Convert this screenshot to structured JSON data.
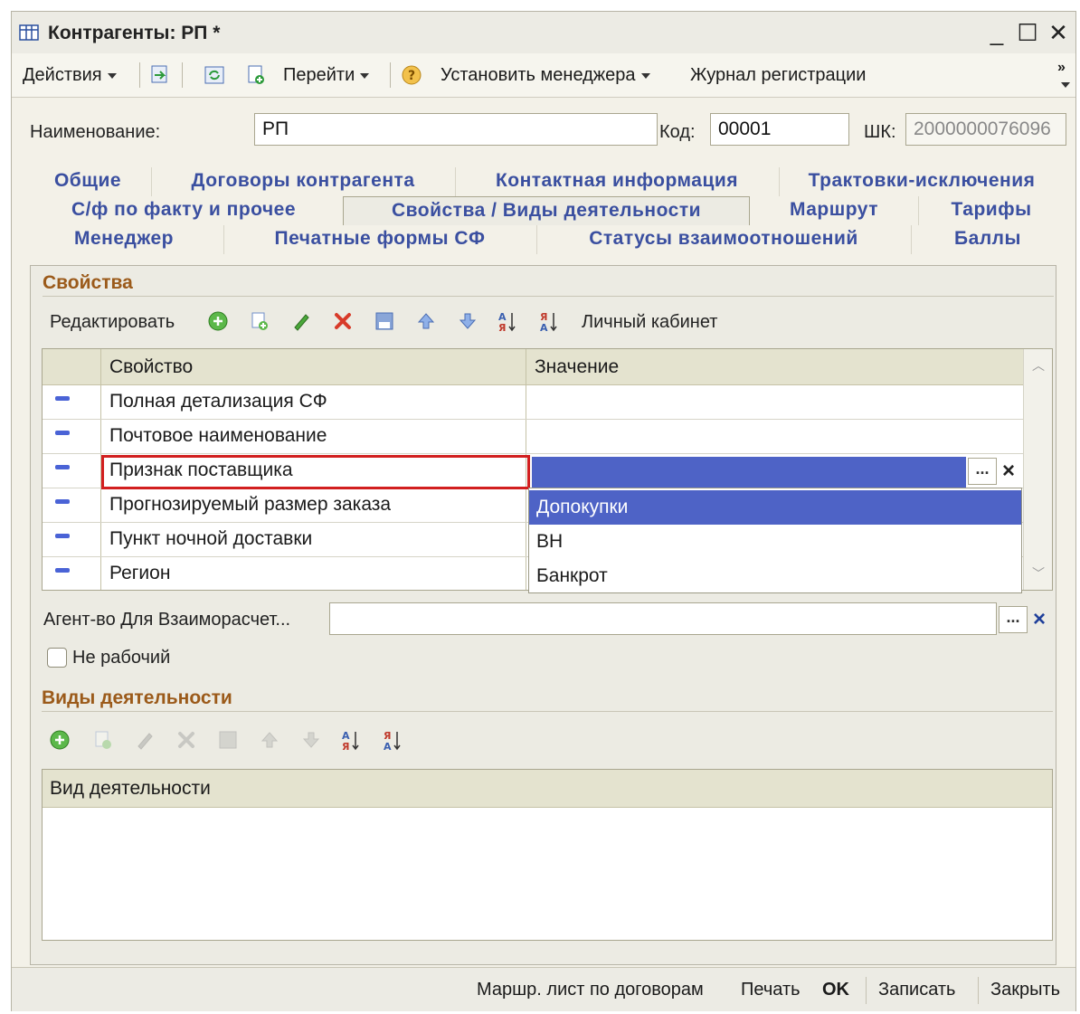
{
  "window": {
    "title": "Контрагенты: РП *",
    "minimize": "_",
    "maximize": "☐",
    "close": "✕"
  },
  "toolbar": {
    "actions": "Действия",
    "goto": "Перейти",
    "set_manager": "Установить менеджера",
    "registration_log": "Журнал регистрации",
    "more": "»"
  },
  "form": {
    "name_label": "Наименование:",
    "name_value": "РП",
    "code_label": "Код:",
    "code_value": "00001",
    "barcode_label": "ШК:",
    "barcode_value": "2000000076096"
  },
  "tabs": {
    "row1": [
      "Общие",
      "Договоры контрагента",
      "Контактная информация",
      "Трактовки-исключения"
    ],
    "row2": [
      "С/ф по факту и прочее",
      "Свойства / Виды деятельности",
      "Маршрут",
      "Тарифы"
    ],
    "row3": [
      "Менеджер",
      "Печатные формы СФ",
      "Статусы взаимоотношений",
      "Баллы"
    ]
  },
  "properties": {
    "section_title": "Свойства",
    "edit_label": "Редактировать",
    "cabinet_label": "Личный кабинет",
    "col_property": "Свойство",
    "col_value": "Значение",
    "rows": [
      {
        "name": "Полная детализация СФ",
        "value": ""
      },
      {
        "name": "Почтовое наименование",
        "value": ""
      },
      {
        "name": "Признак поставщика",
        "value": ""
      },
      {
        "name": "Прогнозируемый размер заказа",
        "value": ""
      },
      {
        "name": "Пункт ночной доставки",
        "value": ""
      },
      {
        "name": "Регион",
        "value": ""
      }
    ],
    "dropdown": [
      "Допокупки",
      "ВН",
      "Банкрот"
    ],
    "ellipsis": "...",
    "clear": "×"
  },
  "agency": {
    "label": "Агент-во Для Взаиморасчет...",
    "value": ""
  },
  "not_working": {
    "label": "Не рабочий",
    "checked": false
  },
  "activities": {
    "section_title": "Виды деятельности",
    "col_activity": "Вид деятельности"
  },
  "footer": {
    "route_sheet": "Маршр. лист по договорам",
    "print": "Печать",
    "ok": "OK",
    "save": "Записать",
    "close": "Закрыть"
  },
  "colors": {
    "tab_text": "#3a4fa0",
    "section_text": "#9b5a1a",
    "selection": "#4e63c6",
    "highlight_border": "#d21f1f"
  }
}
